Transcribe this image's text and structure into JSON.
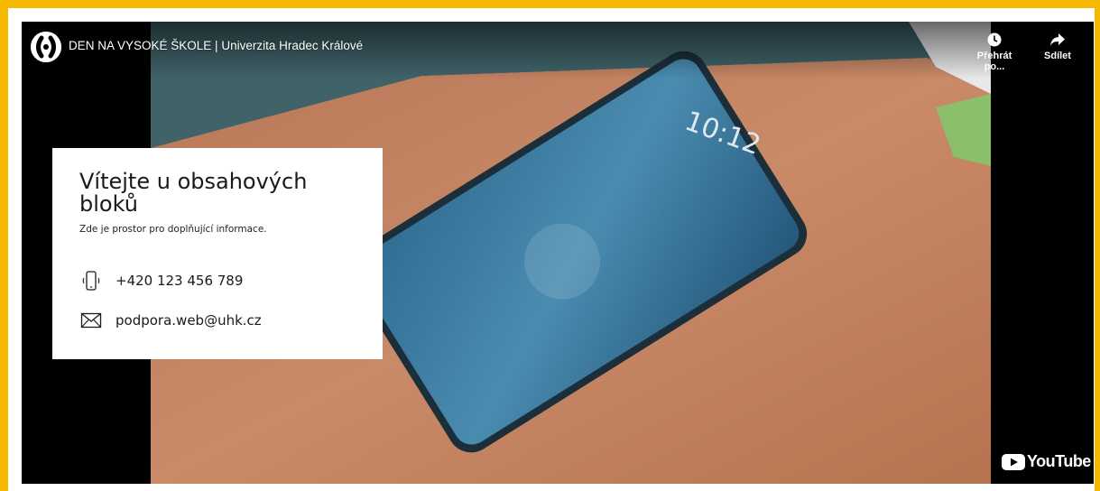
{
  "frame": {
    "accent": "#f5b800"
  },
  "video": {
    "title": "DEN NA VYSOKÉ ŠKOLE | Univerzita Hradec Králové",
    "channel_icon": "uhk-logo-icon",
    "actions": {
      "watch_later": {
        "label": "Přehrát po...",
        "icon": "clock-icon"
      },
      "share": {
        "label": "Sdílet",
        "icon": "share-arrow-icon"
      }
    },
    "brand": {
      "label": "YouTube",
      "icon": "youtube-play-icon",
      "color": "#ff0000"
    },
    "thumbnail": {
      "phone_time": "10:12"
    }
  },
  "card": {
    "title": "Vítejte u obsahových bloků",
    "subtitle": "Zde je prostor pro doplňující informace.",
    "phone": {
      "icon": "phone-icon",
      "value": "+420 123 456 789"
    },
    "email": {
      "icon": "envelope-icon",
      "value": "podpora.web@uhk.cz"
    }
  }
}
